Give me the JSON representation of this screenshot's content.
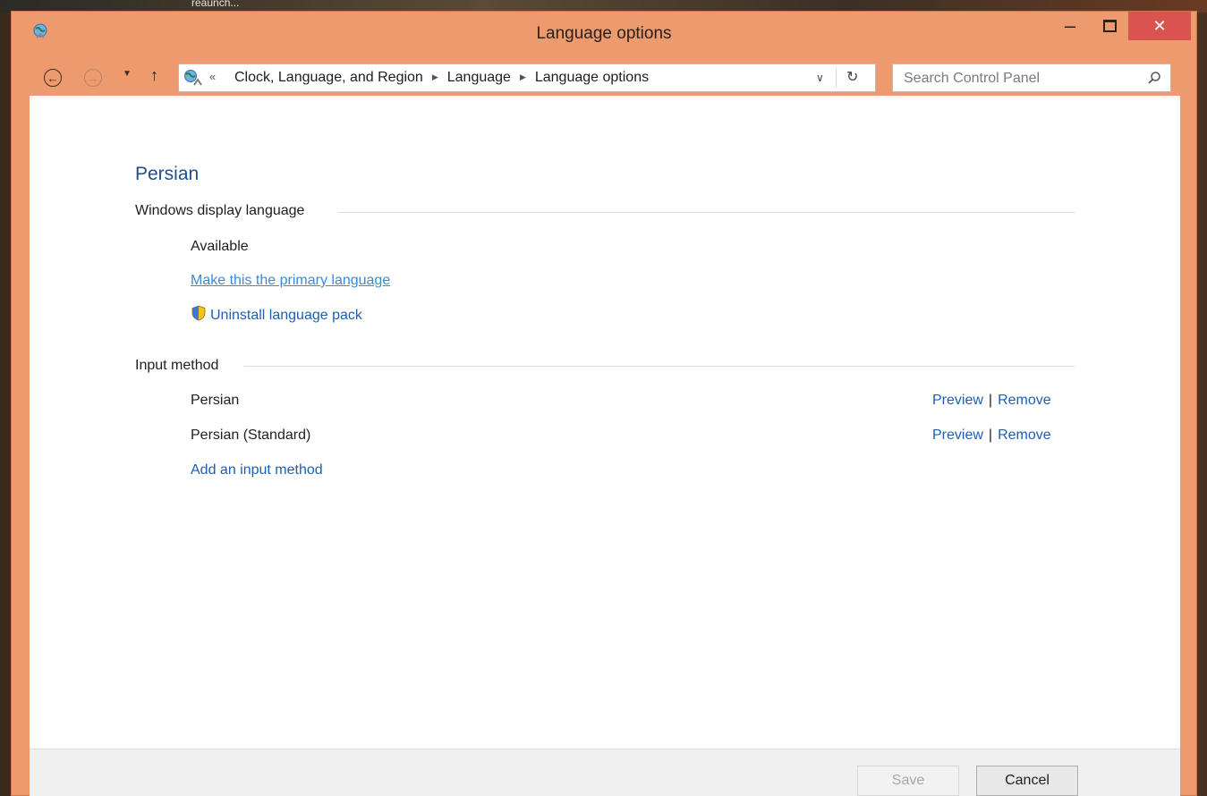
{
  "desktop": {
    "partial_label": "reaunch..."
  },
  "window": {
    "title": "Language options",
    "controls": {
      "minimize": "–",
      "close": "✕"
    },
    "accent_color": "#ec9a6e"
  },
  "navigation": {
    "address_chevrons": "«",
    "breadcrumbs": [
      {
        "label": "Clock, Language, and Region"
      },
      {
        "label": "Language"
      },
      {
        "label": "Language options"
      }
    ],
    "search": {
      "placeholder": "Search Control Panel"
    }
  },
  "main": {
    "language_name": "Persian",
    "display_language": {
      "heading": "Windows display language",
      "status": "Available",
      "make_primary_link": "Make this the primary language",
      "uninstall_link": "Uninstall language pack"
    },
    "input_method": {
      "heading": "Input method",
      "methods": [
        {
          "name": "Persian",
          "preview_label": "Preview",
          "separator": "|",
          "remove_label": "Remove"
        },
        {
          "name": "Persian (Standard)",
          "preview_label": "Preview",
          "separator": "|",
          "remove_label": "Remove"
        }
      ],
      "add_link": "Add an input method"
    }
  },
  "footer": {
    "save_label": "Save",
    "save_enabled": false,
    "cancel_label": "Cancel"
  }
}
